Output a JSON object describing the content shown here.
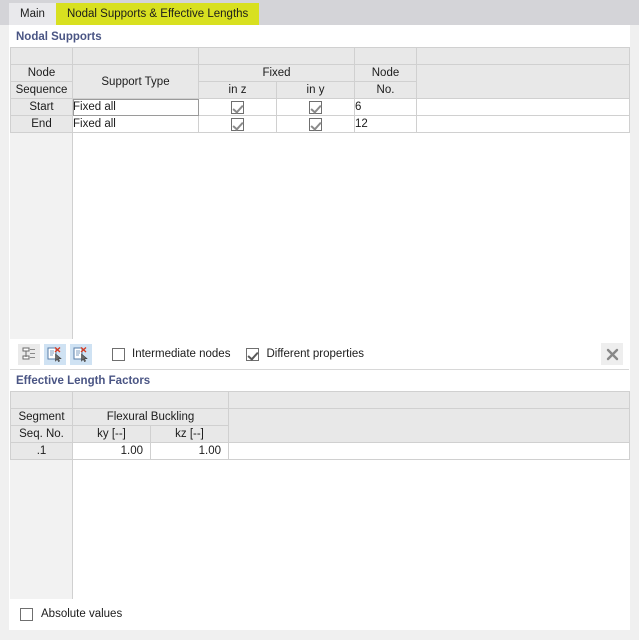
{
  "tabs": [
    {
      "label": "Main",
      "active": false
    },
    {
      "label": "Nodal Supports & Effective Lengths",
      "active": true
    }
  ],
  "nodal_supports": {
    "section_title": "Nodal Supports",
    "headers": {
      "node_sequence_l1": "Node",
      "node_sequence_l2": "Sequence",
      "support_type": "Support Type",
      "fixed_group": "Fixed",
      "fixed_in_z": "in z",
      "fixed_in_y": "in y",
      "node_no_l1": "Node",
      "node_no_l2": "No."
    },
    "rows": [
      {
        "sequence": "Start",
        "support_type": "Fixed all",
        "in_z": true,
        "in_y": true,
        "node_no": "6",
        "focused": true
      },
      {
        "sequence": "End",
        "support_type": "Fixed all",
        "in_z": true,
        "in_y": true,
        "node_no": "12",
        "focused": false
      }
    ]
  },
  "toolbar": {
    "buttons": [
      {
        "icon": "list-indent-icon",
        "state": "plain"
      },
      {
        "icon": "delete-document-cursor-icon",
        "state": "tint"
      },
      {
        "icon": "delete-document-cursor-alt-icon",
        "state": "tint"
      }
    ],
    "intermediate_nodes": {
      "label": "Intermediate nodes",
      "checked": false
    },
    "different_properties": {
      "label": "Different properties",
      "checked": true
    },
    "close_icon": "close-icon"
  },
  "effective_lengths": {
    "section_title": "Effective Length Factors",
    "headers": {
      "segment_l1": "Segment",
      "segment_l2": "Seq. No.",
      "flexural_buckling": "Flexural Buckling",
      "ky": "ky [--]",
      "kz": "kz [--]"
    },
    "rows": [
      {
        "segment": ".1",
        "ky": "1.00",
        "kz": "1.00"
      }
    ]
  },
  "footer": {
    "absolute_values": {
      "label": "Absolute values",
      "checked": false
    }
  },
  "colors": {
    "tab_highlight": "#d8e020",
    "section_header": "#4a5584",
    "header_bg": "#e8e8e8",
    "window_bg": "#f0f0f0",
    "tabstrip_bg": "#d4d4d8"
  }
}
